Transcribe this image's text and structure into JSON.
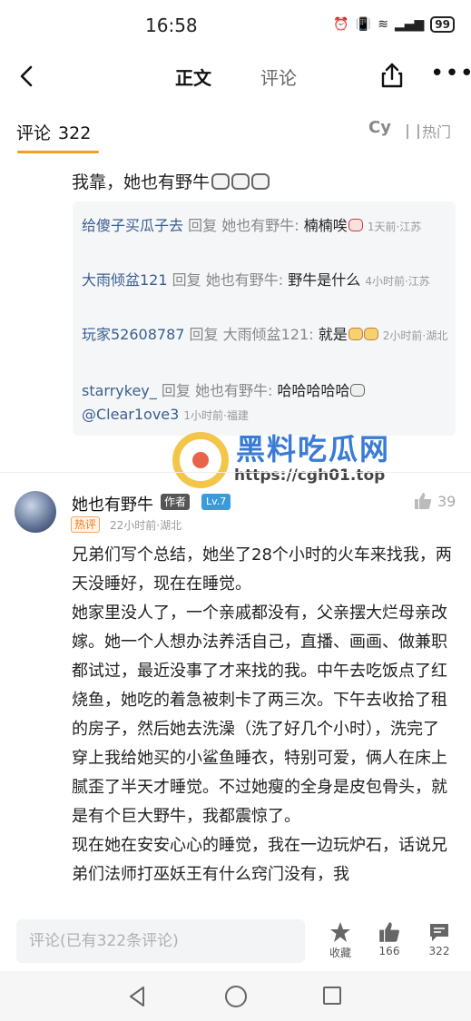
{
  "status": {
    "time": "16:58",
    "battery": "99"
  },
  "nav": {
    "tab_main": "正文",
    "tab_comments": "评论"
  },
  "comments_header": {
    "title": "评论",
    "count": "322",
    "cy": "Cy",
    "sort": "热门"
  },
  "previous_comment": {
    "text": "我靠，她也有野牛"
  },
  "replies": [
    {
      "user": "给傻子买瓜子去",
      "reply_word": "回复",
      "target": "她也有野牛:",
      "text": "楠楠唉",
      "meta": "1天前·江苏"
    },
    {
      "user": "大雨倾盆121",
      "reply_word": "回复",
      "target": "她也有野牛:",
      "text": "野牛是什么",
      "meta": "4小时前·江苏"
    },
    {
      "user": "玩家52608787",
      "reply_word": "回复",
      "target": "大雨倾盆121:",
      "text": "就是",
      "meta": "2小时前·湖北"
    },
    {
      "user": "starrykey_",
      "reply_word": "回复",
      "target": "她也有野牛:",
      "text": "哈哈哈哈哈",
      "mention": "@Clear1ove3",
      "meta": "1小时前·福建"
    }
  ],
  "watermark": {
    "title": "黑料吃瓜网",
    "url": "https://cgh01.top"
  },
  "main_comment": {
    "author": "她也有野牛",
    "author_badge": "作者",
    "level": "Lv.7",
    "hot_tag": "热评",
    "meta": "22小时前·湖北",
    "likes": "39",
    "paragraphs": [
      "兄弟们写个总结，她坐了28个小时的火车来找我，两天没睡好，现在在睡觉。",
      "她家里没人了，一个亲戚都没有，父亲摆大烂母亲改嫁。她一个人想办法养活自己，直播、画画、做兼职都试过，最近没事了才来找的我。中午去吃饭点了红烧鱼，她吃的着急被刺卡了两三次。下午去收拾了租的房子，然后她去洗澡（洗了好几个小时），洗完了穿上我给她买的小鲨鱼睡衣，特别可爱，俩人在床上腻歪了半天才睡觉。不过她瘦的全身是皮包骨头，就是有个巨大野牛，我都震惊了。",
      "现在她在安安心心的睡觉，我在一边玩炉石，话说兄弟们法师打巫妖王有什么窍门没有，我"
    ]
  },
  "bottom_bar": {
    "input_placeholder": "评论(已有322条评论)",
    "favorite_label": "收藏",
    "like_count": "166",
    "comment_count": "322"
  }
}
